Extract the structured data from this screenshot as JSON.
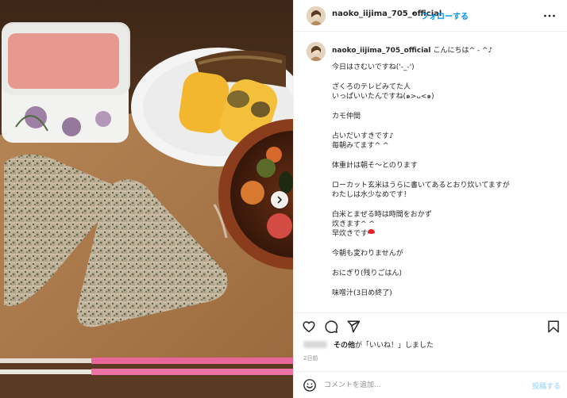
{
  "header": {
    "username": "naoko_iijima_705_official",
    "separator": "•",
    "follow_label": "フォローする",
    "more_icon": "more-horizontal-icon"
  },
  "caption": {
    "username": "naoko_iijima_705_official",
    "greeting": "こんにちは^ - ^♪",
    "lines": [
      "今日はさむいですね('-_-')",
      "",
      "ざくろのテレビみてた人",
      "いっぱいいたんですね(๑>ᴗ<๑)",
      "",
      "カモ仲間",
      "",
      "占いだいすきです♪",
      "毎朝みてます^ ^",
      "",
      "体重計は朝そ〜とのります",
      "",
      "ローカット玄米はうらに書いてあるとおり炊いてますが",
      "わたしは水少なめです！",
      "",
      "白米とまぜる時は時間をおかず",
      "炊きます^ ^",
      "早炊きです",
      "",
      "今朝も変わりませんが",
      "",
      "おにぎり(残りごはん)",
      "",
      "味噌汁(3日め終了)"
    ]
  },
  "actions": {
    "like_icon": "heart-icon",
    "comment_icon": "comment-icon",
    "share_icon": "send-icon",
    "save_icon": "bookmark-icon"
  },
  "likes": {
    "prefix_bold": "その他",
    "suffix": "が「いいね！」しました"
  },
  "time_ago": "2日前",
  "comment": {
    "placeholder": "コメントを追加...",
    "post_label": "投稿する",
    "emoji_icon": "smiley-icon"
  },
  "photo": {
    "alt": "onigiri breakfast",
    "next_icon": "chevron-right-icon"
  },
  "colors": {
    "accent": "#0095f6",
    "post_disabled": "#b2dffc",
    "border": "#efefef",
    "muted": "#8e8e8e"
  }
}
